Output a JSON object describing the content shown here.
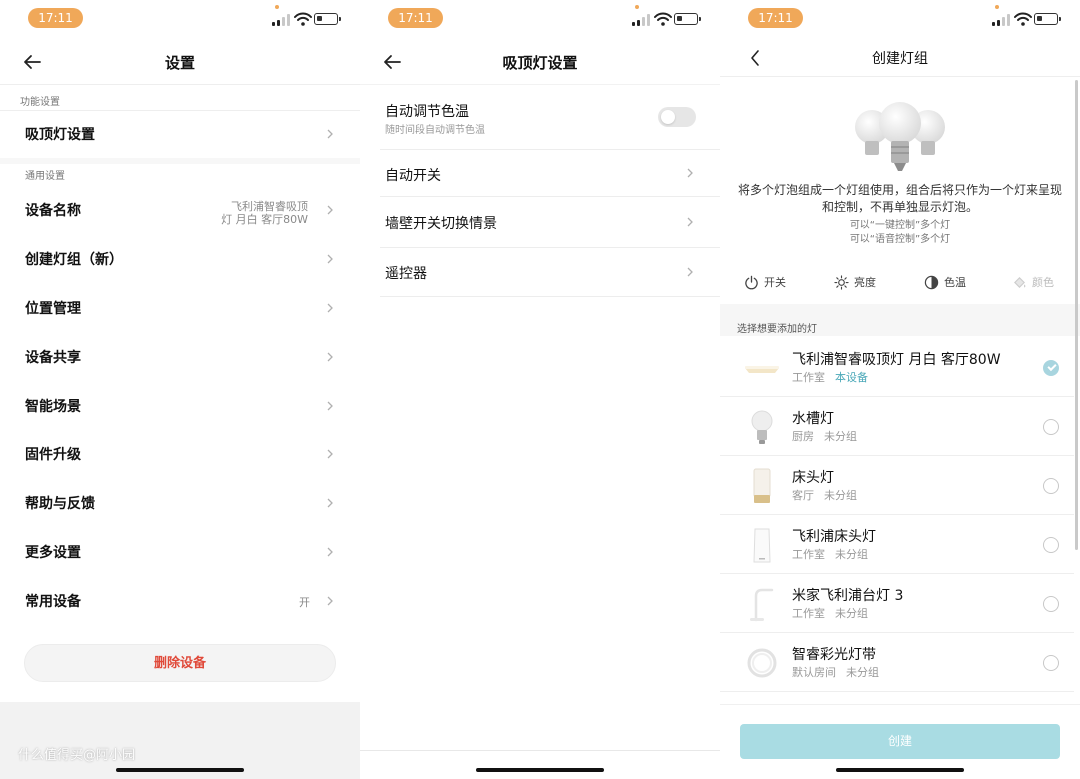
{
  "status_bar": {
    "time": "17:11"
  },
  "colors": {
    "accent_orange": "#f0a859",
    "delete_red": "#e04a3a",
    "teal": "#4aa8b8",
    "create_button": "#a9dce3"
  },
  "settings_screen": {
    "title": "设置",
    "section_function": "功能设置",
    "ceiling_light_settings": "吸顶灯设置",
    "section_general": "通用设置",
    "device_name_label": "设备名称",
    "device_name_value_line1": "飞利浦智睿吸顶",
    "device_name_value_line2": "灯 月白 客厅80W",
    "items": [
      {
        "label": "创建灯组（新）"
      },
      {
        "label": "位置管理"
      },
      {
        "label": "设备共享"
      },
      {
        "label": "智能场景"
      },
      {
        "label": "固件升级"
      },
      {
        "label": "帮助与反馈"
      },
      {
        "label": "更多设置"
      }
    ],
    "common_device_label": "常用设备",
    "common_device_value": "开",
    "delete_button": "删除设备",
    "watermark": "什么值得买@阿小园"
  },
  "ceiling_screen": {
    "title": "吸顶灯设置",
    "auto_color_temp_label": "自动调节色温",
    "auto_color_temp_sub": "随时间段自动调节色温",
    "auto_color_temp_on": false,
    "items": [
      {
        "label": "自动开关"
      },
      {
        "label": "墙壁开关切换情景"
      },
      {
        "label": "遥控器"
      }
    ]
  },
  "group_screen": {
    "title": "创建灯组",
    "description": "将多个灯泡组成一个灯组使用，组合后将只作为一个灯来呈现和控制，不再单独显示灯泡。",
    "note_1": "可以“一键控制”多个灯",
    "note_2": "可以“语音控制”多个灯",
    "controls": {
      "power": "开关",
      "brightness": "亮度",
      "color_temp": "色温",
      "color": "颜色"
    },
    "select_label": "选择想要添加的灯",
    "devices": [
      {
        "name": "飞利浦智睿吸顶灯 月白 客厅80W",
        "room": "工作室",
        "status": "本设备",
        "selected": true,
        "icon": "ceiling-light-icon"
      },
      {
        "name": "水槽灯",
        "room": "厨房",
        "status": "未分组",
        "selected": false,
        "icon": "bulb-icon"
      },
      {
        "name": "床头灯",
        "room": "客厅",
        "status": "未分组",
        "selected": false,
        "icon": "bedside-lamp-icon"
      },
      {
        "name": "飞利浦床头灯",
        "room": "工作室",
        "status": "未分组",
        "selected": false,
        "icon": "bedside-lamp-white-icon"
      },
      {
        "name": "米家飞利浦台灯 3",
        "room": "工作室",
        "status": "未分组",
        "selected": false,
        "icon": "desk-lamp-icon"
      },
      {
        "name": "智睿彩光灯带",
        "room": "默认房间",
        "status": "未分组",
        "selected": false,
        "icon": "light-strip-icon"
      }
    ],
    "create_button": "创建"
  }
}
